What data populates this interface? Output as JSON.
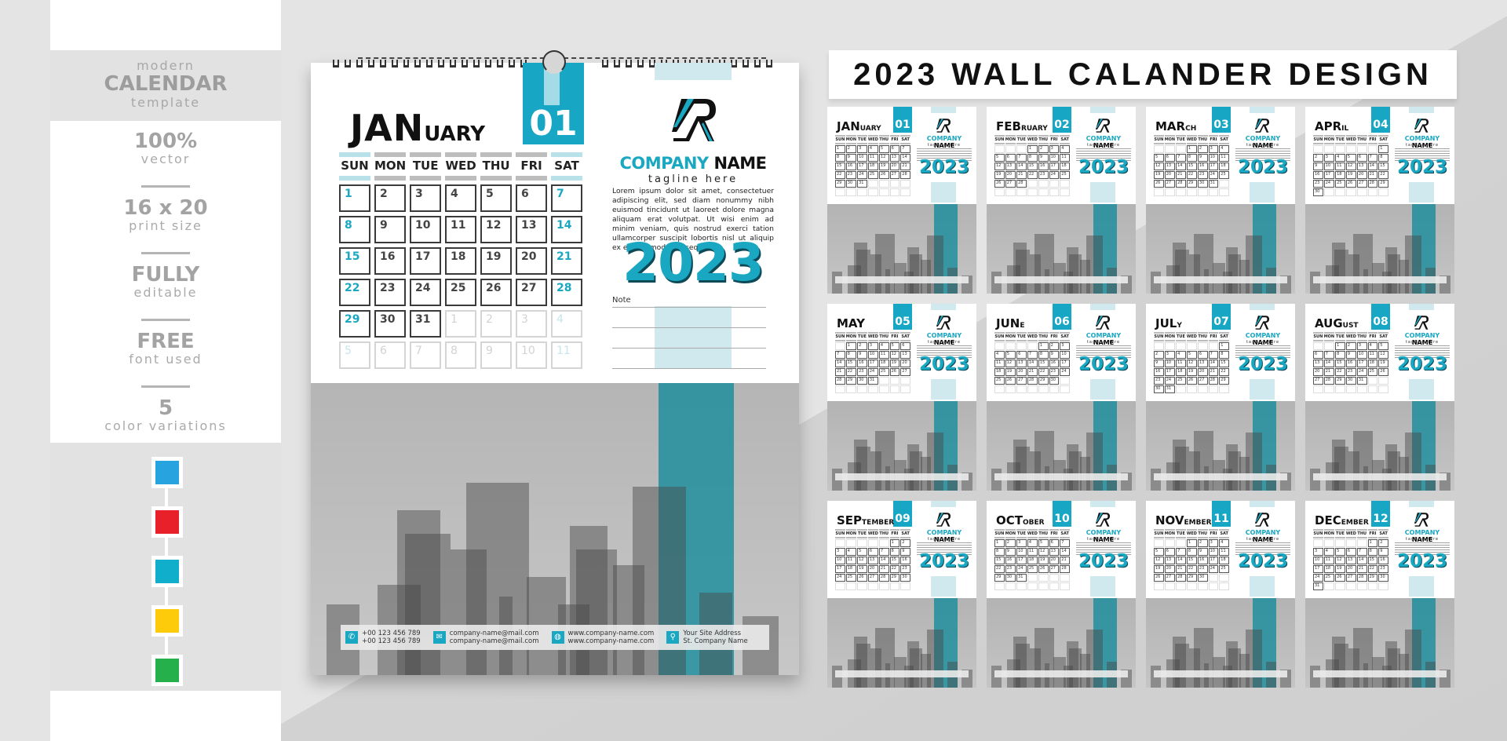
{
  "sidebar": {
    "title_small": "modern",
    "title_big": "CALENDAR",
    "title_sub": "template",
    "features": [
      {
        "big": "100%",
        "small": "vector"
      },
      {
        "big": "16 x 20",
        "small": "print size"
      },
      {
        "big": "FULLY",
        "small": "editable"
      },
      {
        "big": "FREE",
        "small": "font used"
      },
      {
        "big": "5",
        "small": "color variations"
      }
    ],
    "swatches": [
      "#27a3e0",
      "#e8202a",
      "#11aecb",
      "#fdcb0a",
      "#26b04b"
    ]
  },
  "main_calendar": {
    "month_big": "JAN",
    "month_small": "UARY",
    "month_number": "01",
    "weekdays": [
      "SUN",
      "MON",
      "TUE",
      "WED",
      "THU",
      "FRI",
      "SAT"
    ],
    "days": [
      "1",
      "2",
      "3",
      "4",
      "5",
      "6",
      "7",
      "8",
      "9",
      "10",
      "11",
      "12",
      "13",
      "14",
      "15",
      "16",
      "17",
      "18",
      "19",
      "20",
      "21",
      "22",
      "23",
      "24",
      "25",
      "26",
      "27",
      "28",
      "29",
      "30",
      "31",
      "1",
      "2",
      "3",
      "4",
      "5",
      "6",
      "7",
      "8",
      "9",
      "10",
      "11"
    ],
    "muted_from_index": 31,
    "company_part1": "COMPANY",
    "company_part2": " NAME",
    "tagline": "tagline here",
    "lorem": "Lorem ipsum dolor sit amet, consectetuer adipiscing elit, sed diam nonummy nibh euismod tincidunt ut laoreet dolore magna aliquam erat volutpat. Ut wisi enim ad minim veniam, quis nostrud exerci tation ullamcorper suscipit lobortis nisl ut aliquip ex ea commodo consequat.",
    "year": "2023",
    "note_label": "Note",
    "contacts": [
      {
        "icon": "phone-icon",
        "glyph": "✆",
        "line1": "+00 123 456 789",
        "line2": "+00 123 456 789"
      },
      {
        "icon": "mail-icon",
        "glyph": "✉",
        "line1": "company-name@mail.com",
        "line2": "company-name@mail.com"
      },
      {
        "icon": "globe-icon",
        "glyph": "◍",
        "line1": "www.company-name.com",
        "line2": "www.company-name.com"
      },
      {
        "icon": "location-icon",
        "glyph": "⚲",
        "line1": "Your Site Address",
        "line2": "St. Company Name"
      }
    ]
  },
  "headline": "2023 WALL CALANDER DESIGN",
  "colors": {
    "accent": "#19a7c2",
    "teal_band": "#178c9b"
  },
  "thumbnails": [
    {
      "big": "JAN",
      "small": "UARY",
      "num": "01",
      "offset": 0,
      "length": 31
    },
    {
      "big": "FEB",
      "small": "RUARY",
      "num": "02",
      "offset": 3,
      "length": 28
    },
    {
      "big": "MAR",
      "small": "CH",
      "num": "03",
      "offset": 3,
      "length": 31
    },
    {
      "big": "APR",
      "small": "IL",
      "num": "04",
      "offset": 6,
      "length": 30
    },
    {
      "big": "MAY",
      "small": "",
      "num": "05",
      "offset": 1,
      "length": 31
    },
    {
      "big": "JUN",
      "small": "E",
      "num": "06",
      "offset": 4,
      "length": 30
    },
    {
      "big": "JUL",
      "small": "Y",
      "num": "07",
      "offset": 6,
      "length": 31
    },
    {
      "big": "AUG",
      "small": "UST",
      "num": "08",
      "offset": 2,
      "length": 31
    },
    {
      "big": "SEP",
      "small": "TEMBER",
      "num": "09",
      "offset": 5,
      "length": 30
    },
    {
      "big": "OCT",
      "small": "OBER",
      "num": "10",
      "offset": 0,
      "length": 31
    },
    {
      "big": "NOV",
      "small": "EMBER",
      "num": "11",
      "offset": 3,
      "length": 30
    },
    {
      "big": "DEC",
      "small": "EMBER",
      "num": "12",
      "offset": 5,
      "length": 31
    }
  ],
  "thumb_company_part1": "COMPANY",
  "thumb_company_part2": " NAME",
  "thumb_tagline": "tagline here",
  "thumb_year": "2023"
}
